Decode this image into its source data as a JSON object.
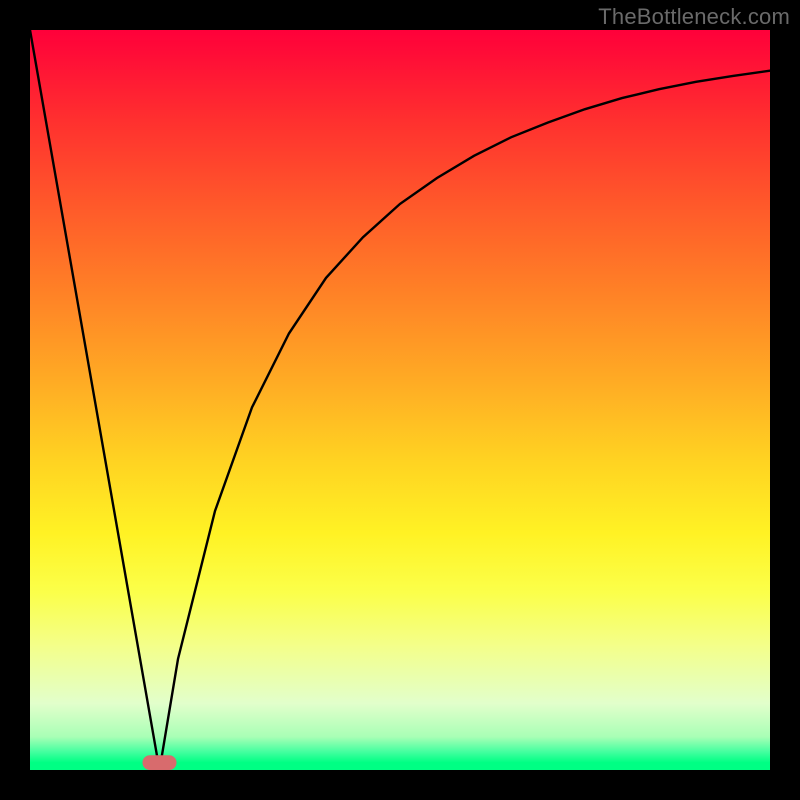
{
  "watermark": "TheBottleneck.com",
  "chart_data": {
    "type": "line",
    "title": "",
    "xlabel": "",
    "ylabel": "",
    "xlim": [
      0,
      100
    ],
    "ylim": [
      0,
      100
    ],
    "grid": false,
    "series": [
      {
        "name": "left-line",
        "x": [
          0,
          17.5
        ],
        "values": [
          100,
          0
        ]
      },
      {
        "name": "right-curve",
        "x": [
          17.5,
          20,
          25,
          30,
          35,
          40,
          45,
          50,
          55,
          60,
          65,
          70,
          75,
          80,
          85,
          90,
          95,
          100
        ],
        "values": [
          0,
          15,
          35,
          49,
          59,
          66.5,
          72,
          76.5,
          80,
          83,
          85.5,
          87.5,
          89.3,
          90.8,
          92,
          93,
          93.8,
          94.5
        ]
      }
    ],
    "marker": {
      "name": "optimal-point",
      "x": 17.5,
      "y": 0,
      "halfwidth_x": 2.3,
      "height_y": 2.0,
      "radius_y": 1.0,
      "color": "#d86b6d"
    }
  }
}
